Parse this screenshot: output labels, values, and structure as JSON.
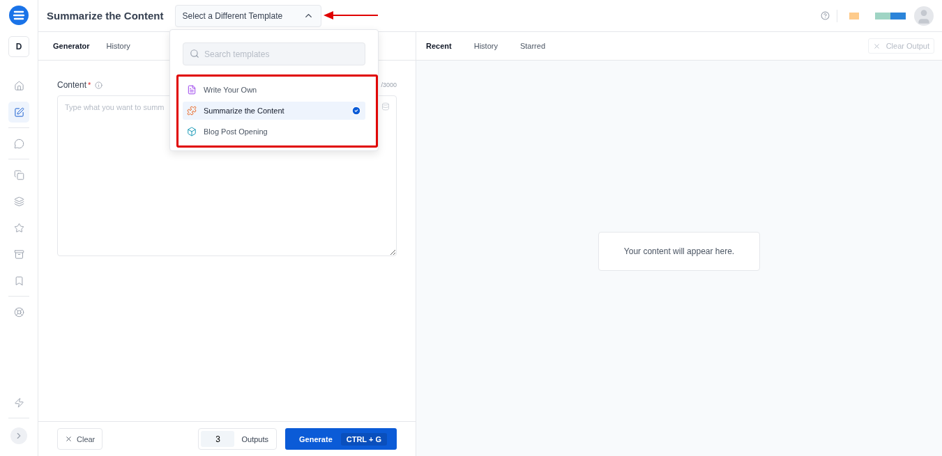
{
  "header": {
    "title": "Summarize the Content",
    "template_button": "Select a Different Template"
  },
  "sidebar": {
    "workspace": "D",
    "items": [
      {
        "selected": false
      },
      {
        "selected": true
      },
      {
        "selected": false
      },
      {
        "selected": false
      },
      {
        "selected": false
      },
      {
        "selected": false
      },
      {
        "selected": false
      },
      {
        "selected": false
      },
      {
        "selected": false
      }
    ]
  },
  "left_tabs": [
    {
      "label": "Generator",
      "selected": true
    },
    {
      "label": "History",
      "selected": false
    }
  ],
  "form": {
    "label": "Content",
    "required_mark": "*",
    "counter": "/3000",
    "placeholder": "Type what you want to summ"
  },
  "footer": {
    "clear": "Clear",
    "outputs_value": "3",
    "outputs_label": "Outputs",
    "generate": "Generate",
    "shortcut": "CTRL + G"
  },
  "dropdown": {
    "search_placeholder": "Search templates",
    "items": [
      {
        "label": "Write Your Own",
        "selected": false
      },
      {
        "label": "Summarize the Content",
        "selected": true
      },
      {
        "label": "Blog Post Opening",
        "selected": false
      }
    ]
  },
  "right_tabs": [
    {
      "label": "Recent",
      "selected": true
    },
    {
      "label": "History",
      "selected": false
    },
    {
      "label": "Starred",
      "selected": false
    }
  ],
  "clear_output": {
    "label": "Clear Output",
    "disabled": true
  },
  "empty_message": "Your content will appear here."
}
